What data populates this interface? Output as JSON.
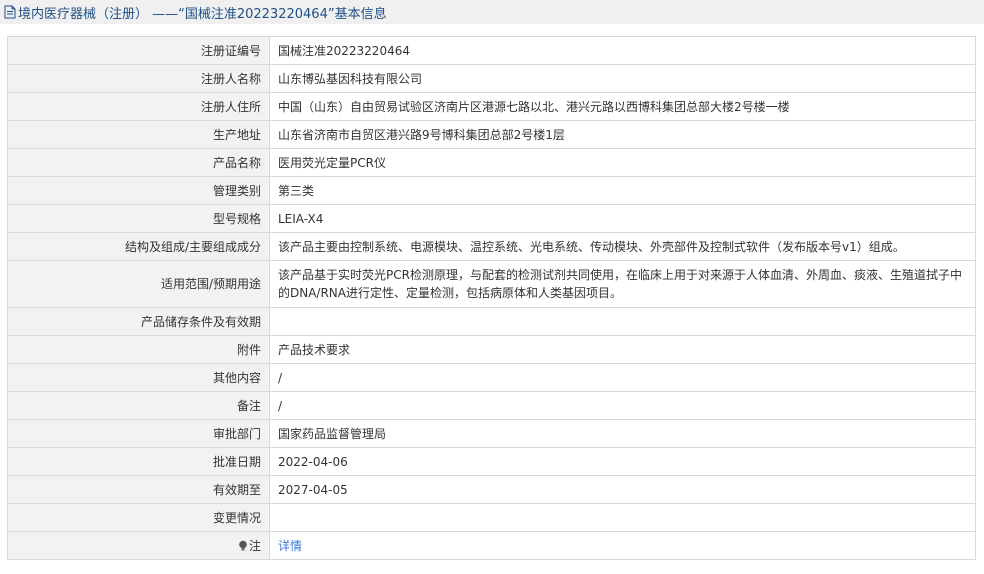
{
  "header": {
    "title": "境内医疗器械（注册） ——“国械注准20223220464”基本信息"
  },
  "rows": [
    {
      "label": "注册证编号",
      "value": "国械注准20223220464"
    },
    {
      "label": "注册人名称",
      "value": "山东博弘基因科技有限公司"
    },
    {
      "label": "注册人住所",
      "value": "中国（山东）自由贸易试验区济南片区港源七路以北、港兴元路以西博科集团总部大楼2号楼一楼"
    },
    {
      "label": "生产地址",
      "value": "山东省济南市自贸区港兴路9号博科集团总部2号楼1层"
    },
    {
      "label": "产品名称",
      "value": "医用荧光定量PCR仪"
    },
    {
      "label": "管理类别",
      "value": "第三类"
    },
    {
      "label": "型号规格",
      "value": "LEIA-X4"
    },
    {
      "label": "结构及组成/主要组成成分",
      "value": "该产品主要由控制系统、电源模块、温控系统、光电系统、传动模块、外壳部件及控制式软件（发布版本号v1）组成。"
    },
    {
      "label": "适用范围/预期用途",
      "value": "该产品基于实时荧光PCR检测原理，与配套的检测试剂共同使用，在临床上用于对来源于人体血清、外周血、痰液、生殖道拭子中的DNA/RNA进行定性、定量检测，包括病原体和人类基因项目。"
    },
    {
      "label": "产品储存条件及有效期",
      "value": ""
    },
    {
      "label": "附件",
      "value": "产品技术要求"
    },
    {
      "label": "其他内容",
      "value": "/"
    },
    {
      "label": "备注",
      "value": "/"
    },
    {
      "label": "审批部门",
      "value": "国家药品监督管理局"
    },
    {
      "label": "批准日期",
      "value": "2022-04-06"
    },
    {
      "label": "有效期至",
      "value": "2027-04-05"
    },
    {
      "label": "变更情况",
      "value": ""
    },
    {
      "label": "注",
      "value": "详情"
    }
  ],
  "icons": {
    "header": "document-icon",
    "note": "lightbulb-icon"
  },
  "colors": {
    "header_text": "#1f4f86",
    "link": "#3a7bd5",
    "label_bg": "#f2f2f2"
  }
}
